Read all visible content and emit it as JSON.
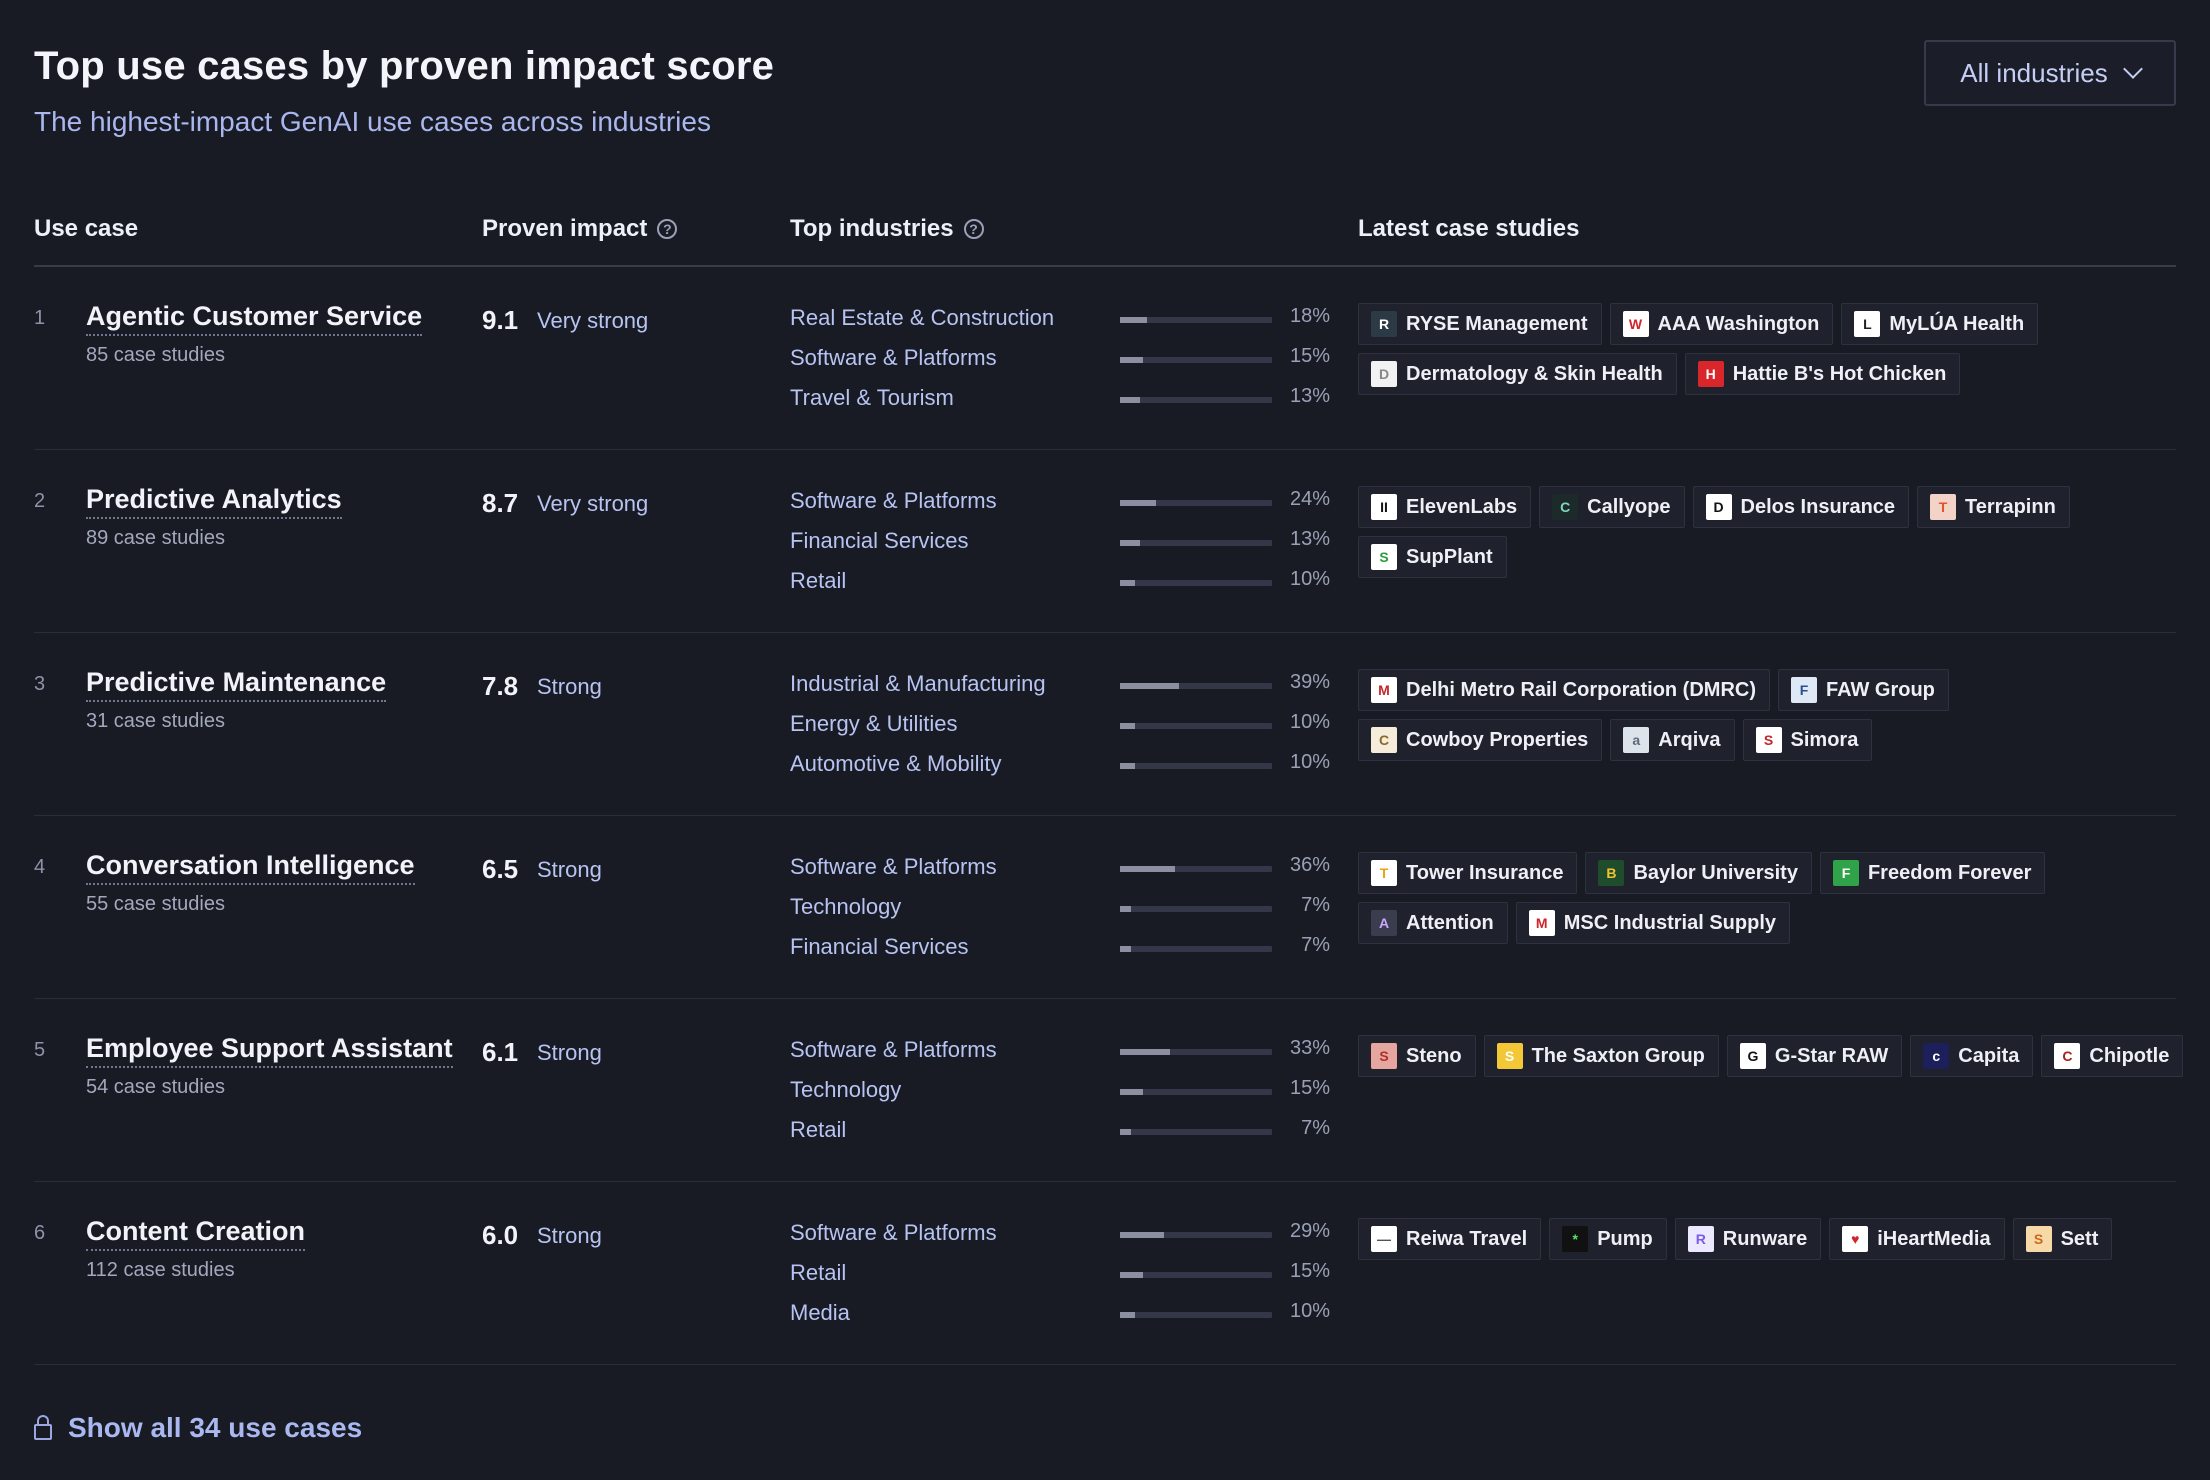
{
  "header": {
    "title": "Top use cases by proven impact score",
    "subtitle": "The highest-impact GenAI use cases across industries",
    "filter_label": "All industries"
  },
  "columns": {
    "use_case": "Use case",
    "proven_impact": "Proven impact",
    "top_industries": "Top industries",
    "latest_case_studies": "Latest case studies"
  },
  "rows": [
    {
      "rank": "1",
      "name": "Agentic Customer Service",
      "count": "85 case studies",
      "score": "9.1",
      "score_label": "Very strong",
      "industries": [
        {
          "name": "Real Estate & Construction",
          "pct_text": "18%",
          "pct": 18
        },
        {
          "name": "Software & Platforms",
          "pct_text": "15%",
          "pct": 15
        },
        {
          "name": "Travel & Tourism",
          "pct_text": "13%",
          "pct": 13
        }
      ],
      "studies": [
        {
          "name": "RYSE Management",
          "logo": "R",
          "bg": "#2b3a44",
          "fg": "#ffffff"
        },
        {
          "name": "AAA Washington",
          "logo": "W",
          "bg": "#ffffff",
          "fg": "#d0262b"
        },
        {
          "name": "MyLÚA Health",
          "logo": "L",
          "bg": "#ffffff",
          "fg": "#222222"
        },
        {
          "name": "Dermatology & Skin Health",
          "logo": "D",
          "bg": "#f2f2f2",
          "fg": "#888888"
        },
        {
          "name": "Hattie B's Hot Chicken",
          "logo": "H",
          "bg": "#d9262b",
          "fg": "#ffffff"
        }
      ]
    },
    {
      "rank": "2",
      "name": "Predictive Analytics",
      "count": "89 case studies",
      "score": "8.7",
      "score_label": "Very strong",
      "industries": [
        {
          "name": "Software & Platforms",
          "pct_text": "24%",
          "pct": 24
        },
        {
          "name": "Financial Services",
          "pct_text": "13%",
          "pct": 13
        },
        {
          "name": "Retail",
          "pct_text": "10%",
          "pct": 10
        }
      ],
      "studies": [
        {
          "name": "ElevenLabs",
          "logo": "II",
          "bg": "#ffffff",
          "fg": "#111111"
        },
        {
          "name": "Callyope",
          "logo": "C",
          "bg": "#1d2a2a",
          "fg": "#7fd6c2"
        },
        {
          "name": "Delos Insurance",
          "logo": "D",
          "bg": "#ffffff",
          "fg": "#111111"
        },
        {
          "name": "Terrapinn",
          "logo": "T",
          "bg": "#f3d2c8",
          "fg": "#e1542c"
        },
        {
          "name": "SupPlant",
          "logo": "S",
          "bg": "#ffffff",
          "fg": "#2c9b3e"
        }
      ]
    },
    {
      "rank": "3",
      "name": "Predictive Maintenance",
      "count": "31 case studies",
      "score": "7.8",
      "score_label": "Strong",
      "industries": [
        {
          "name": "Industrial & Manufacturing",
          "pct_text": "39%",
          "pct": 39
        },
        {
          "name": "Energy & Utilities",
          "pct_text": "10%",
          "pct": 10
        },
        {
          "name": "Automotive & Mobility",
          "pct_text": "10%",
          "pct": 10
        }
      ],
      "studies": [
        {
          "name": "Delhi Metro Rail Corporation (DMRC)",
          "logo": "M",
          "bg": "#ffffff",
          "fg": "#c4262b"
        },
        {
          "name": "FAW Group",
          "logo": "F",
          "bg": "#dfe8f5",
          "fg": "#2a4f8f"
        },
        {
          "name": "Cowboy Properties",
          "logo": "C",
          "bg": "#f5ecd9",
          "fg": "#8a6a2c"
        },
        {
          "name": "Arqiva",
          "logo": "a",
          "bg": "#dde3ea",
          "fg": "#5b6b7c"
        },
        {
          "name": "Simora",
          "logo": "S",
          "bg": "#ffffff",
          "fg": "#c4262b"
        }
      ]
    },
    {
      "rank": "4",
      "name": "Conversation Intelligence",
      "count": "55 case studies",
      "score": "6.5",
      "score_label": "Strong",
      "industries": [
        {
          "name": "Software & Platforms",
          "pct_text": "36%",
          "pct": 36
        },
        {
          "name": "Technology",
          "pct_text": "7%",
          "pct": 7
        },
        {
          "name": "Financial Services",
          "pct_text": "7%",
          "pct": 7
        }
      ],
      "studies": [
        {
          "name": "Tower Insurance",
          "logo": "T",
          "bg": "#ffffff",
          "fg": "#e8a11a"
        },
        {
          "name": "Baylor University",
          "logo": "B",
          "bg": "#1f4d2c",
          "fg": "#f2c230"
        },
        {
          "name": "Freedom Forever",
          "logo": "F",
          "bg": "#2fa24a",
          "fg": "#ffffff"
        },
        {
          "name": "Attention",
          "logo": "A",
          "bg": "#3a3d4d",
          "fg": "#c9a7ff"
        },
        {
          "name": "MSC Industrial Supply",
          "logo": "M",
          "bg": "#ffffff",
          "fg": "#d0262b"
        }
      ]
    },
    {
      "rank": "5",
      "name": "Employee Support Assistant",
      "count": "54 case studies",
      "score": "6.1",
      "score_label": "Strong",
      "industries": [
        {
          "name": "Software & Platforms",
          "pct_text": "33%",
          "pct": 33
        },
        {
          "name": "Technology",
          "pct_text": "15%",
          "pct": 15
        },
        {
          "name": "Retail",
          "pct_text": "7%",
          "pct": 7
        }
      ],
      "studies": [
        {
          "name": "Steno",
          "logo": "S",
          "bg": "#e6a6a0",
          "fg": "#b03028"
        },
        {
          "name": "The Saxton Group",
          "logo": "S",
          "bg": "#f3c736",
          "fg": "#ffffff"
        },
        {
          "name": "G-Star RAW",
          "logo": "G",
          "bg": "#ffffff",
          "fg": "#111111"
        },
        {
          "name": "Capita",
          "logo": "c",
          "bg": "#1c1f5a",
          "fg": "#ffffff"
        },
        {
          "name": "Chipotle",
          "logo": "C",
          "bg": "#ffffff",
          "fg": "#a8241c"
        }
      ]
    },
    {
      "rank": "6",
      "name": "Content Creation",
      "count": "112 case studies",
      "score": "6.0",
      "score_label": "Strong",
      "industries": [
        {
          "name": "Software & Platforms",
          "pct_text": "29%",
          "pct": 29
        },
        {
          "name": "Retail",
          "pct_text": "15%",
          "pct": 15
        },
        {
          "name": "Media",
          "pct_text": "10%",
          "pct": 10
        }
      ],
      "studies": [
        {
          "name": "Reiwa Travel",
          "logo": "—",
          "bg": "#ffffff",
          "fg": "#555555"
        },
        {
          "name": "Pump",
          "logo": "*",
          "bg": "#111111",
          "fg": "#57e06a"
        },
        {
          "name": "Runware",
          "logo": "R",
          "bg": "#ece8ff",
          "fg": "#7b5ce6"
        },
        {
          "name": "iHeartMedia",
          "logo": "♥",
          "bg": "#ffffff",
          "fg": "#d0262b"
        },
        {
          "name": "Sett",
          "logo": "S",
          "bg": "#f7d9a8",
          "fg": "#c96a1c"
        }
      ]
    }
  ],
  "footer": {
    "show_all_label": "Show all 34 use cases"
  }
}
